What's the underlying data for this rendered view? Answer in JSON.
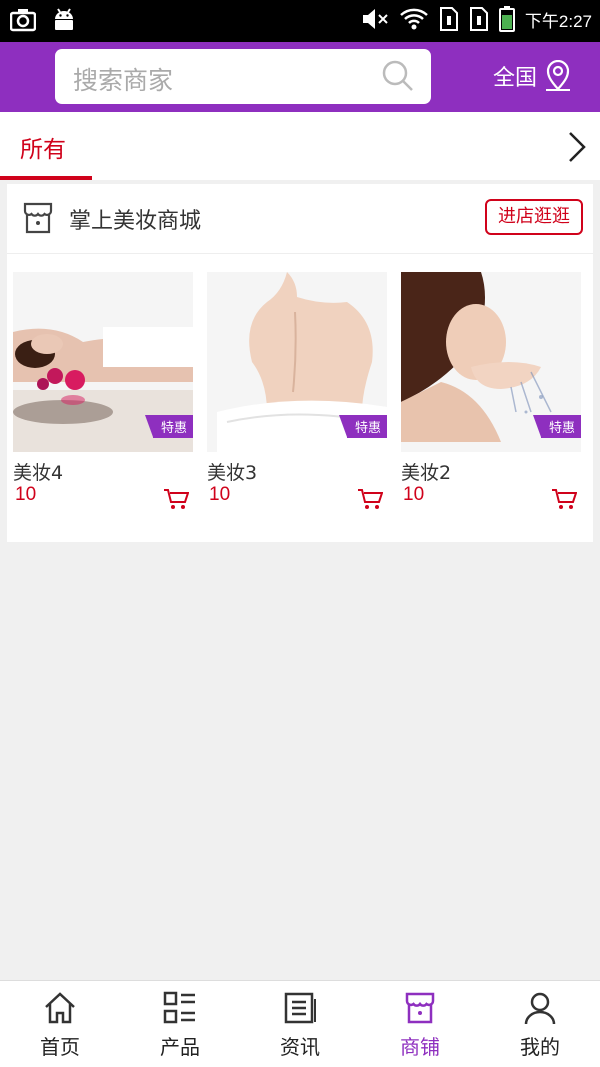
{
  "status_bar": {
    "time": "下午2:27",
    "icons": [
      "camera-icon",
      "android-icon",
      "mute-icon",
      "wifi-icon",
      "sim1-icon",
      "sim2-icon",
      "battery-icon"
    ]
  },
  "header": {
    "search_placeholder": "搜索商家",
    "region": "全国",
    "accent_color": "#8e2fbf"
  },
  "tabs": {
    "active": "所有",
    "active_color": "#d0021b"
  },
  "shop": {
    "name": "掌上美妆商城",
    "visit_label": "进店逛逛",
    "products": [
      {
        "name": "美妆4",
        "price": "10",
        "badge": "特惠"
      },
      {
        "name": "美妆3",
        "price": "10",
        "badge": "特惠"
      },
      {
        "name": "美妆2",
        "price": "10",
        "badge": "特惠"
      }
    ]
  },
  "bottom_nav": {
    "items": [
      {
        "label": "首页",
        "icon": "home-icon"
      },
      {
        "label": "产品",
        "icon": "grid-list-icon"
      },
      {
        "label": "资讯",
        "icon": "news-icon"
      },
      {
        "label": "商铺",
        "icon": "store-icon"
      },
      {
        "label": "我的",
        "icon": "user-icon"
      }
    ],
    "active_index": 3
  }
}
